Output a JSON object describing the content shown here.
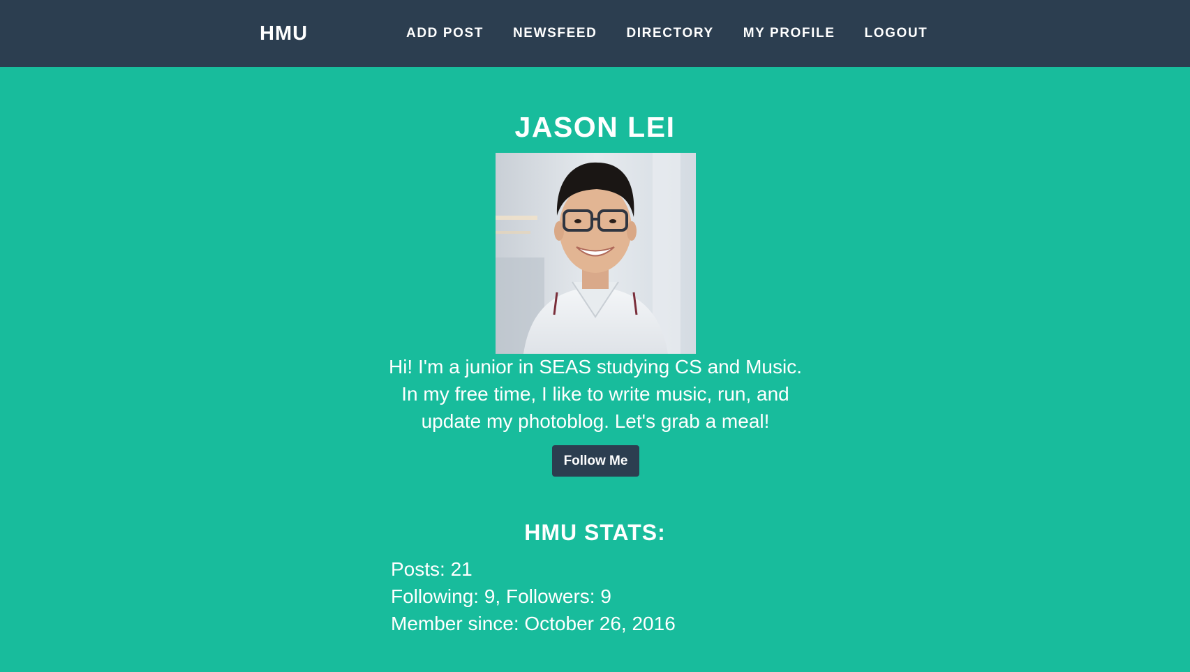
{
  "navbar": {
    "brand": "HMU",
    "items": [
      {
        "label": "ADD POST"
      },
      {
        "label": "NEWSFEED"
      },
      {
        "label": "DIRECTORY"
      },
      {
        "label": "MY PROFILE"
      },
      {
        "label": "LOGOUT"
      }
    ]
  },
  "profile": {
    "name": "JASON LEI",
    "bio": "Hi! I'm a junior in SEAS studying CS and Music. In my free time, I like to write music, run, and update my photoblog. Let's grab a meal!",
    "follow_label": "Follow Me"
  },
  "stats": {
    "heading": "HMU STATS:",
    "posts": "Posts: 21",
    "follow_counts": "Following: 9, Followers: 9",
    "member_since": "Member since: October 26, 2016"
  },
  "colors": {
    "navbar": "#2c3e50",
    "background": "#18bc9c",
    "button": "#2c3e50"
  }
}
